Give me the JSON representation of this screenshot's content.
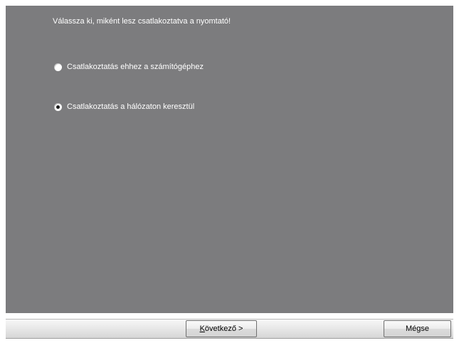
{
  "dialog": {
    "prompt": "Válassza ki, miként lesz csatlakoztatva a nyomtató!",
    "options": [
      {
        "label": "Csatlakoztatás ehhez a számítógéphez",
        "selected": false
      },
      {
        "label": "Csatlakoztatás a hálózaton keresztül",
        "selected": true
      }
    ]
  },
  "buttons": {
    "next": {
      "accel": "K",
      "rest": "övetkező >"
    },
    "cancel": "Mégse"
  },
  "colors": {
    "panel_background": "#7c7c7e",
    "text": "#ffffff"
  }
}
